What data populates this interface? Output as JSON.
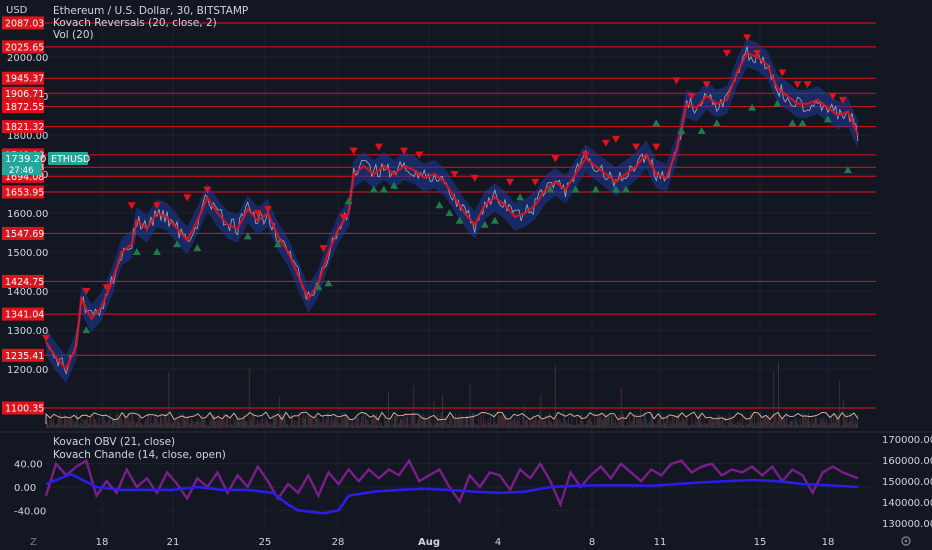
{
  "legend": {
    "title": "Ethereum / U.S. Dollar, 30, BITSTAMP",
    "indicator1": "Kovach Reversals (20, close, 2)",
    "indicator2": "Vol (20)",
    "indicator3": "Kovach OBV (21, close)",
    "indicator4": "Kovach Chande (14, close, open)"
  },
  "axis": {
    "currency": "USD",
    "timezone_badge": "Z",
    "settings_icon": "gear-icon",
    "current_price": "1739.20",
    "current_symbol": "ETHUSD",
    "countdown": "27:46"
  },
  "colors": {
    "background": "#131722",
    "level_line": "#e0131c",
    "price": "#bfbfbf",
    "trend_red": "#e0131c",
    "trend_blue": "#1c3b9c",
    "buy_marker": "#1e7b4a",
    "sell_marker": "#e0131c",
    "obv": "#2b1de8",
    "chande": "#7a1e8c",
    "current_price_badge": "#26a69a"
  },
  "chart_data": [
    {
      "type": "line",
      "name": "price",
      "y_axis_ticks": [
        1200,
        1300,
        1400,
        1500,
        1600,
        1700,
        1800,
        1900,
        2000
      ],
      "ylim": [
        1088,
        2092
      ],
      "x_ticks": [
        "18",
        "21",
        "25",
        "28",
        "Aug",
        "4",
        "8",
        "11",
        "15",
        "18"
      ],
      "horizontal_levels": [
        2087.03,
        2025.65,
        1945.37,
        1906.71,
        1872.55,
        1821.32,
        1748.98,
        1717.28,
        1694.08,
        1653.95,
        1547.69,
        1424.75,
        1341.04,
        1235.41,
        1100.35
      ],
      "price_path": [
        [
          0,
          1270
        ],
        [
          2,
          1230
        ],
        [
          4,
          1200
        ],
        [
          6,
          1260
        ],
        [
          7,
          1380
        ],
        [
          9,
          1330
        ],
        [
          11,
          1360
        ],
        [
          13,
          1420
        ],
        [
          15,
          1500
        ],
        [
          17,
          1520
        ],
        [
          18,
          1580
        ],
        [
          20,
          1560
        ],
        [
          22,
          1600
        ],
        [
          24,
          1590
        ],
        [
          26,
          1560
        ],
        [
          28,
          1530
        ],
        [
          30,
          1580
        ],
        [
          32,
          1640
        ],
        [
          34,
          1600
        ],
        [
          36,
          1570
        ],
        [
          38,
          1560
        ],
        [
          40,
          1610
        ],
        [
          42,
          1580
        ],
        [
          44,
          1600
        ],
        [
          46,
          1540
        ],
        [
          48,
          1500
        ],
        [
          50,
          1440
        ],
        [
          52,
          1380
        ],
        [
          54,
          1420
        ],
        [
          56,
          1500
        ],
        [
          58,
          1560
        ],
        [
          60,
          1600
        ],
        [
          61,
          1700
        ],
        [
          63,
          1720
        ],
        [
          65,
          1700
        ],
        [
          67,
          1720
        ],
        [
          69,
          1700
        ],
        [
          71,
          1720
        ],
        [
          73,
          1710
        ],
        [
          75,
          1690
        ],
        [
          77,
          1700
        ],
        [
          79,
          1680
        ],
        [
          81,
          1640
        ],
        [
          83,
          1600
        ],
        [
          85,
          1570
        ],
        [
          87,
          1620
        ],
        [
          89,
          1640
        ],
        [
          91,
          1620
        ],
        [
          93,
          1590
        ],
        [
          95,
          1600
        ],
        [
          97,
          1620
        ],
        [
          99,
          1660
        ],
        [
          101,
          1680
        ],
        [
          103,
          1660
        ],
        [
          105,
          1700
        ],
        [
          107,
          1740
        ],
        [
          109,
          1720
        ],
        [
          111,
          1700
        ],
        [
          113,
          1680
        ],
        [
          115,
          1700
        ],
        [
          117,
          1720
        ],
        [
          119,
          1750
        ],
        [
          121,
          1700
        ],
        [
          123,
          1690
        ],
        [
          125,
          1760
        ],
        [
          127,
          1880
        ],
        [
          129,
          1870
        ],
        [
          131,
          1900
        ],
        [
          133,
          1880
        ],
        [
          135,
          1890
        ],
        [
          137,
          1960
        ],
        [
          139,
          2010
        ],
        [
          141,
          2000
        ],
        [
          143,
          1980
        ],
        [
          145,
          1920
        ],
        [
          147,
          1900
        ],
        [
          149,
          1880
        ],
        [
          151,
          1880
        ],
        [
          153,
          1890
        ],
        [
          155,
          1870
        ],
        [
          157,
          1850
        ],
        [
          159,
          1860
        ],
        [
          161,
          1800
        ]
      ],
      "buy_markers": [
        [
          8,
          1300
        ],
        [
          18,
          1500
        ],
        [
          22,
          1500
        ],
        [
          26,
          1520
        ],
        [
          30,
          1510
        ],
        [
          40,
          1540
        ],
        [
          46,
          1520
        ],
        [
          54,
          1410
        ],
        [
          56,
          1420
        ],
        [
          60,
          1630
        ],
        [
          65,
          1660
        ],
        [
          67,
          1660
        ],
        [
          69,
          1670
        ],
        [
          78,
          1620
        ],
        [
          80,
          1600
        ],
        [
          82,
          1580
        ],
        [
          87,
          1570
        ],
        [
          89,
          1580
        ],
        [
          94,
          1640
        ],
        [
          100,
          1660
        ],
        [
          105,
          1660
        ],
        [
          109,
          1660
        ],
        [
          113,
          1660
        ],
        [
          115,
          1660
        ],
        [
          121,
          1830
        ],
        [
          126,
          1810
        ],
        [
          130,
          1810
        ],
        [
          133,
          1830
        ],
        [
          140,
          1870
        ],
        [
          145,
          1880
        ],
        [
          148,
          1830
        ],
        [
          150,
          1830
        ],
        [
          155,
          1840
        ],
        [
          159,
          1710
        ]
      ],
      "sell_markers": [
        [
          0,
          1280
        ],
        [
          8,
          1400
        ],
        [
          12,
          1410
        ],
        [
          17,
          1620
        ],
        [
          22,
          1620
        ],
        [
          28,
          1640
        ],
        [
          32,
          1660
        ],
        [
          42,
          1600
        ],
        [
          44,
          1610
        ],
        [
          55,
          1510
        ],
        [
          59,
          1590
        ],
        [
          61,
          1760
        ],
        [
          66,
          1770
        ],
        [
          71,
          1760
        ],
        [
          74,
          1750
        ],
        [
          81,
          1700
        ],
        [
          85,
          1690
        ],
        [
          92,
          1680
        ],
        [
          97,
          1680
        ],
        [
          101,
          1740
        ],
        [
          107,
          1750
        ],
        [
          111,
          1780
        ],
        [
          113,
          1790
        ],
        [
          117,
          1770
        ],
        [
          121,
          1770
        ],
        [
          125,
          1940
        ],
        [
          128,
          1900
        ],
        [
          131,
          1930
        ],
        [
          135,
          2010
        ],
        [
          139,
          2050
        ],
        [
          141,
          2010
        ],
        [
          146,
          1960
        ],
        [
          149,
          1930
        ],
        [
          151,
          1930
        ],
        [
          156,
          1900
        ],
        [
          158,
          1890
        ]
      ]
    },
    {
      "type": "line",
      "name": "oscillators",
      "left_ticks": [
        "40.00",
        "0.00",
        "-40.00"
      ],
      "right_ticks": [
        "170000.00",
        "160000.00",
        "150000.00",
        "140000.00",
        "130000.00"
      ],
      "obv_path": [
        [
          0,
          5
        ],
        [
          5,
          22
        ],
        [
          10,
          0
        ],
        [
          15,
          -5
        ],
        [
          20,
          -5
        ],
        [
          25,
          -5
        ],
        [
          30,
          0
        ],
        [
          35,
          -5
        ],
        [
          40,
          -5
        ],
        [
          45,
          -10
        ],
        [
          48,
          -30
        ],
        [
          50,
          -40
        ],
        [
          55,
          -45
        ],
        [
          58,
          -40
        ],
        [
          60,
          -15
        ],
        [
          65,
          -8
        ],
        [
          70,
          -5
        ],
        [
          75,
          -3
        ],
        [
          80,
          -5
        ],
        [
          85,
          -8
        ],
        [
          90,
          -10
        ],
        [
          95,
          -8
        ],
        [
          100,
          0
        ],
        [
          105,
          2
        ],
        [
          110,
          3
        ],
        [
          115,
          3
        ],
        [
          120,
          2
        ],
        [
          125,
          5
        ],
        [
          130,
          8
        ],
        [
          135,
          10
        ],
        [
          140,
          12
        ],
        [
          145,
          10
        ],
        [
          150,
          5
        ],
        [
          155,
          3
        ],
        [
          161,
          0
        ]
      ],
      "chande_path": [
        [
          0,
          -15
        ],
        [
          2,
          40
        ],
        [
          4,
          20
        ],
        [
          6,
          35
        ],
        [
          8,
          45
        ],
        [
          10,
          -15
        ],
        [
          12,
          10
        ],
        [
          14,
          -10
        ],
        [
          16,
          30
        ],
        [
          18,
          0
        ],
        [
          20,
          15
        ],
        [
          22,
          -10
        ],
        [
          24,
          25
        ],
        [
          26,
          5
        ],
        [
          28,
          -20
        ],
        [
          30,
          15
        ],
        [
          32,
          0
        ],
        [
          34,
          25
        ],
        [
          36,
          -10
        ],
        [
          38,
          20
        ],
        [
          40,
          0
        ],
        [
          42,
          35
        ],
        [
          44,
          10
        ],
        [
          46,
          -20
        ],
        [
          48,
          5
        ],
        [
          50,
          -10
        ],
        [
          52,
          20
        ],
        [
          54,
          -15
        ],
        [
          56,
          25
        ],
        [
          58,
          5
        ],
        [
          60,
          30
        ],
        [
          62,
          10
        ],
        [
          64,
          30
        ],
        [
          66,
          15
        ],
        [
          68,
          30
        ],
        [
          70,
          20
        ],
        [
          72,
          45
        ],
        [
          74,
          10
        ],
        [
          76,
          20
        ],
        [
          78,
          30
        ],
        [
          80,
          0
        ],
        [
          82,
          -25
        ],
        [
          84,
          20
        ],
        [
          86,
          0
        ],
        [
          88,
          25
        ],
        [
          90,
          20
        ],
        [
          92,
          -5
        ],
        [
          94,
          30
        ],
        [
          96,
          15
        ],
        [
          98,
          40
        ],
        [
          100,
          10
        ],
        [
          102,
          -30
        ],
        [
          104,
          25
        ],
        [
          106,
          0
        ],
        [
          108,
          20
        ],
        [
          110,
          35
        ],
        [
          112,
          15
        ],
        [
          114,
          40
        ],
        [
          116,
          25
        ],
        [
          118,
          10
        ],
        [
          120,
          30
        ],
        [
          122,
          20
        ],
        [
          124,
          40
        ],
        [
          126,
          45
        ],
        [
          128,
          25
        ],
        [
          130,
          35
        ],
        [
          132,
          40
        ],
        [
          134,
          20
        ],
        [
          136,
          30
        ],
        [
          138,
          25
        ],
        [
          140,
          35
        ],
        [
          142,
          20
        ],
        [
          144,
          35
        ],
        [
          146,
          10
        ],
        [
          148,
          30
        ],
        [
          150,
          20
        ],
        [
          152,
          -10
        ],
        [
          154,
          25
        ],
        [
          156,
          35
        ],
        [
          158,
          25
        ],
        [
          161,
          15
        ]
      ]
    }
  ]
}
